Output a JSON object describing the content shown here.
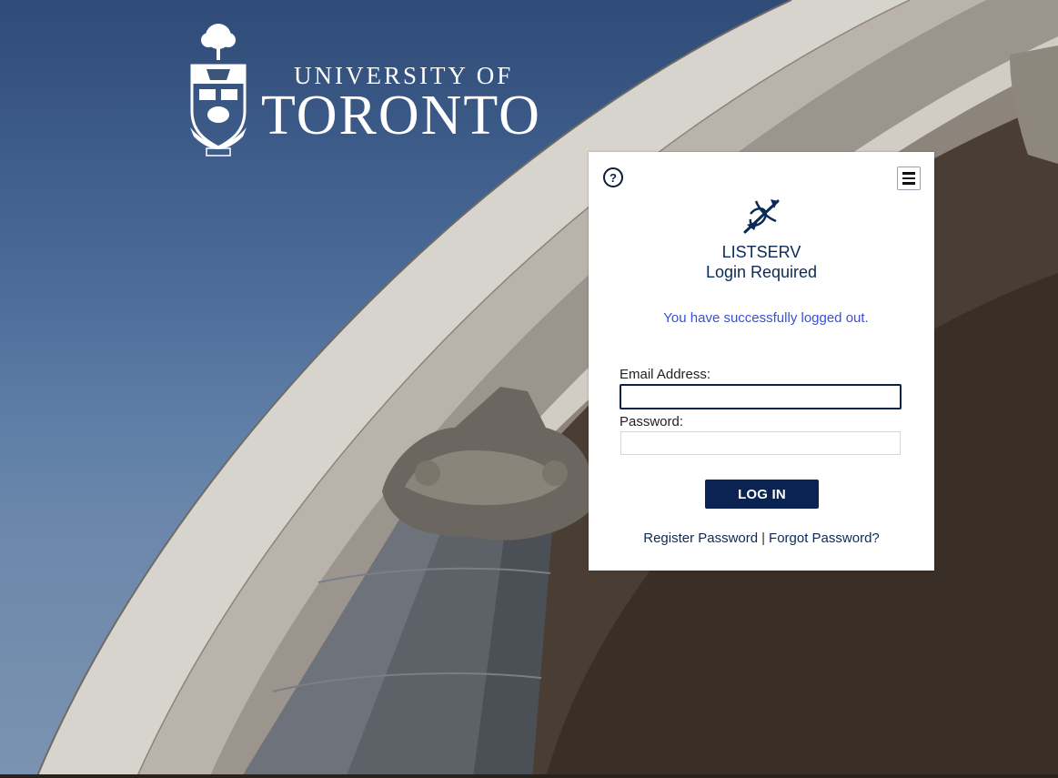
{
  "branding": {
    "university_line1": "UNIVERSITY OF",
    "university_line2": "TORONTO"
  },
  "card": {
    "help_icon": "question-circle-icon",
    "menu_icon": "hamburger-menu-icon",
    "product_icon": "listserv-envelope-icon",
    "title_line1": "LISTSERV",
    "title_line2": "Login Required",
    "status_message": "You have successfully logged out.",
    "email_label": "Email Address:",
    "email_value": "",
    "password_label": "Password:",
    "password_value": "",
    "login_button": "LOG IN",
    "register_link": "Register Password",
    "separator": "|",
    "forgot_link": "Forgot Password?"
  },
  "colors": {
    "navy": "#0a2352",
    "status_blue": "#3b4fd8",
    "card_bg": "#ffffff"
  }
}
